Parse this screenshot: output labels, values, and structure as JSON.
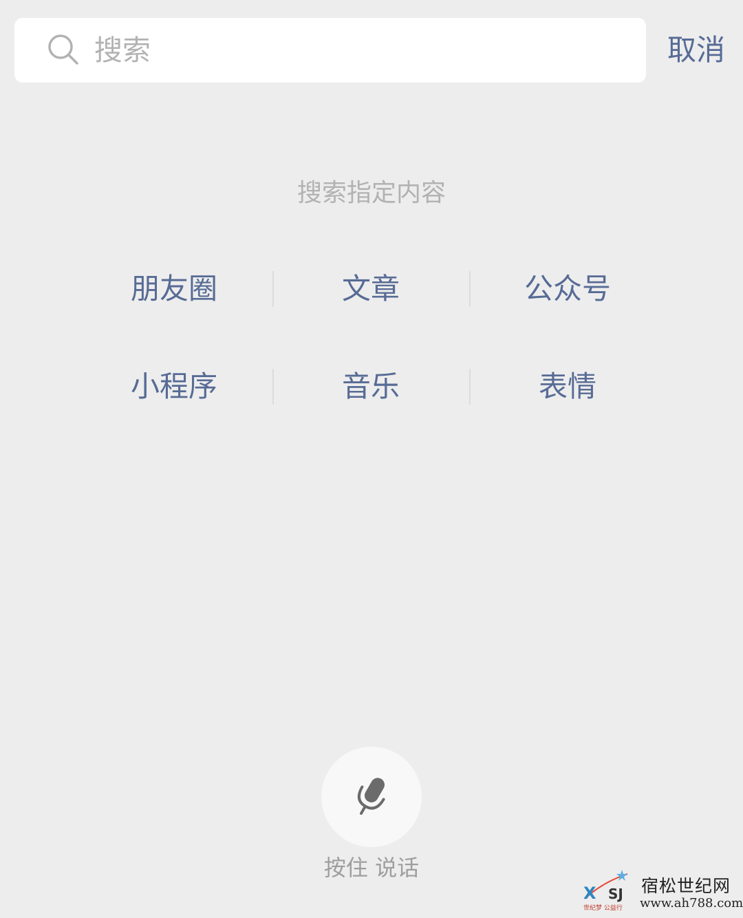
{
  "search": {
    "placeholder": "搜索",
    "value": "",
    "cancel_label": "取消"
  },
  "hint": {
    "text": "搜索指定内容"
  },
  "categories": [
    {
      "label": "朋友圈"
    },
    {
      "label": "文章"
    },
    {
      "label": "公众号"
    },
    {
      "label": "小程序"
    },
    {
      "label": "音乐"
    },
    {
      "label": "表情"
    }
  ],
  "voice": {
    "label": "按住 说话"
  },
  "watermark": {
    "title": "宿松世纪网",
    "url": "www.ah788.com",
    "sub": "世纪梦 公益行"
  },
  "icons": {
    "search": "search-icon",
    "mic": "microphone-icon"
  },
  "colors": {
    "background": "#ededed",
    "link": "#576b95",
    "hint": "#b2b2b2"
  }
}
